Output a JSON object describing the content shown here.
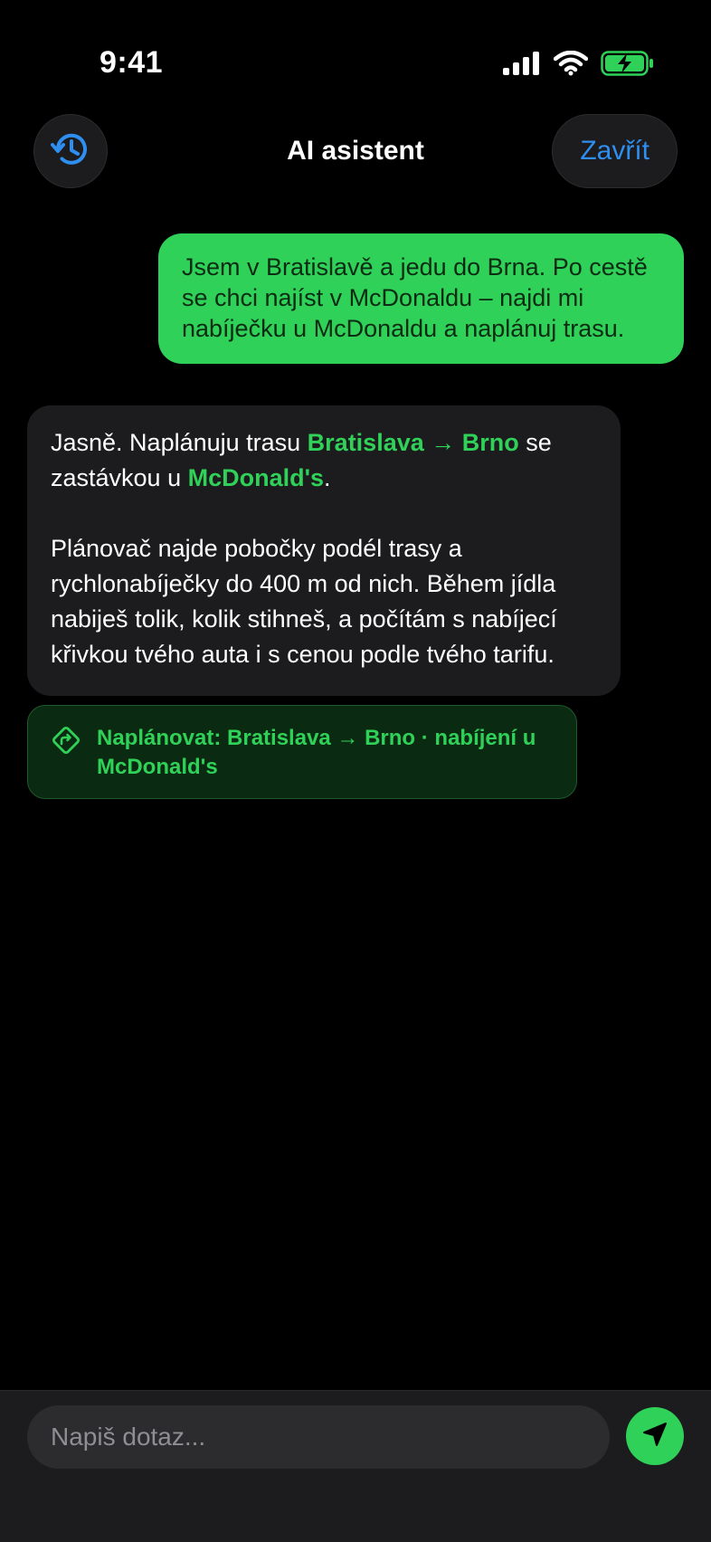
{
  "status_bar": {
    "time": "9:41",
    "icons": [
      "cellular-signal-icon",
      "wifi-icon",
      "battery-charging-icon"
    ]
  },
  "header": {
    "title": "AI asistent",
    "history_icon": "history-icon",
    "close_label": "Zavřít"
  },
  "messages": {
    "user": {
      "text": "Jsem v Bratislavě a jedu do Brna. Po cestě se chci najíst v McDonaldu – najdi mi nabíječku u McDonaldu a naplánuj trasu."
    },
    "assistant": {
      "p1_before": "Jasně. Naplánuju trasu ",
      "p1_route": "Bratislava → Brno",
      "p1_middle": " se zastávkou u ",
      "p1_place": "McDonald's",
      "p1_after": ".",
      "p2": "Plánovač najde pobočky podél trasy a rychlonabíječky do 400 m od nich. Během jídla nabiješ tolik, kolik stihneš, a počítám s nabíjecí křivkou tvého auta i s cenou podle tvého tarifu."
    },
    "action": {
      "icon": "route-sign-icon",
      "label": "Naplánovat: Bratislava → Brno · nabíjení u McDonald's"
    }
  },
  "composer": {
    "placeholder": "Napiš dotaz...",
    "value": "",
    "send_icon": "send-arrow-icon"
  },
  "colors": {
    "accent_green": "#30d158",
    "accent_blue": "#2f8ff0",
    "surface": "#1c1c1e",
    "background": "#000000"
  }
}
